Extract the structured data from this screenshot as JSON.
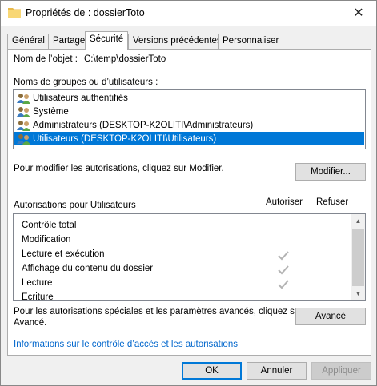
{
  "window": {
    "title": "Propriétés de : dossierToto",
    "folder_icon": "folder-icon",
    "close_label": "✕"
  },
  "tabs": [
    {
      "label": "Général",
      "active": false
    },
    {
      "label": "Partage",
      "active": false
    },
    {
      "label": "Sécurité",
      "active": true
    },
    {
      "label": "Versions précédentes",
      "active": false
    },
    {
      "label": "Personnaliser",
      "active": false
    }
  ],
  "security": {
    "object_name_label": "Nom de l’objet :",
    "object_name_value": "C:\\temp\\dossierToto",
    "groups_label": "Noms de groupes ou d’utilisateurs :",
    "groups": [
      {
        "name": "Utilisateurs authentifiés",
        "icon": "users-icon",
        "selected": false
      },
      {
        "name": "Système",
        "icon": "users-icon",
        "selected": false
      },
      {
        "name": "Administrateurs (DESKTOP-K2OLITI\\Administrateurs)",
        "icon": "users-icon",
        "selected": false
      },
      {
        "name": "Utilisateurs (DESKTOP-K2OLITI\\Utilisateurs)",
        "icon": "users-icon",
        "selected": true
      }
    ],
    "modify_hint": "Pour modifier les autorisations, cliquez sur Modifier.",
    "modify_button": "Modifier...",
    "permissions_label": "Autorisations pour Utilisateurs",
    "allow_header": "Autoriser",
    "deny_header": "Refuser",
    "permissions": [
      {
        "name": "Contrôle total",
        "allow": false
      },
      {
        "name": "Modification",
        "allow": false
      },
      {
        "name": "Lecture et exécution",
        "allow": true
      },
      {
        "name": "Affichage du contenu du dossier",
        "allow": true
      },
      {
        "name": "Lecture",
        "allow": true
      },
      {
        "name": "Écriture",
        "allow": false
      }
    ],
    "advanced_hint_line1": "Pour les autorisations spéciales et les paramètres avancés, cliquez sur",
    "advanced_hint_line2": "Avancé.",
    "advanced_button": "Avancé",
    "info_link": "Informations sur le contrôle d’accès et les autorisations"
  },
  "footer": {
    "ok": "OK",
    "cancel": "Annuler",
    "apply": "Appliquer"
  },
  "colors": {
    "selection": "#0078d7",
    "link": "#0066cc",
    "check": "#b3b3b3"
  }
}
